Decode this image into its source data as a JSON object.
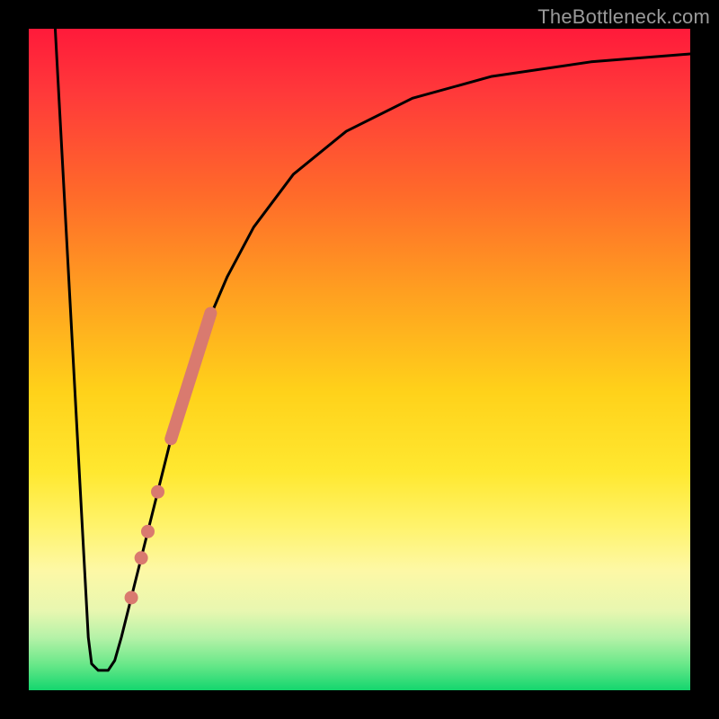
{
  "watermark": "TheBottleneck.com",
  "colors": {
    "curve_stroke": "#000000",
    "dot_fill": "#d97a6f",
    "dot_stroke": "#d97a6f",
    "segment_stroke": "#d97a6f"
  },
  "chart_data": {
    "type": "line",
    "title": "",
    "xlabel": "",
    "ylabel": "",
    "xlim": [
      0,
      100
    ],
    "ylim": [
      0,
      100
    ],
    "curve": [
      {
        "x": 4.0,
        "y": 100.0
      },
      {
        "x": 9.0,
        "y": 8.0
      },
      {
        "x": 9.5,
        "y": 4.0
      },
      {
        "x": 10.5,
        "y": 3.0
      },
      {
        "x": 12.0,
        "y": 3.0
      },
      {
        "x": 13.0,
        "y": 4.5
      },
      {
        "x": 14.0,
        "y": 8.0
      },
      {
        "x": 16.0,
        "y": 16.0
      },
      {
        "x": 18.0,
        "y": 24.0
      },
      {
        "x": 20.0,
        "y": 32.0
      },
      {
        "x": 22.0,
        "y": 40.0
      },
      {
        "x": 24.0,
        "y": 47.0
      },
      {
        "x": 27.0,
        "y": 55.5
      },
      {
        "x": 30.0,
        "y": 62.5
      },
      {
        "x": 34.0,
        "y": 70.0
      },
      {
        "x": 40.0,
        "y": 78.0
      },
      {
        "x": 48.0,
        "y": 84.5
      },
      {
        "x": 58.0,
        "y": 89.5
      },
      {
        "x": 70.0,
        "y": 92.8
      },
      {
        "x": 85.0,
        "y": 95.0
      },
      {
        "x": 100.0,
        "y": 96.2
      }
    ],
    "highlight_segment": {
      "x1": 21.5,
      "y1": 38.0,
      "x2": 27.5,
      "y2": 57.0
    },
    "dots": [
      {
        "x": 19.5,
        "y": 30.0
      },
      {
        "x": 18.0,
        "y": 24.0
      },
      {
        "x": 17.0,
        "y": 20.0
      },
      {
        "x": 15.5,
        "y": 14.0
      }
    ]
  }
}
